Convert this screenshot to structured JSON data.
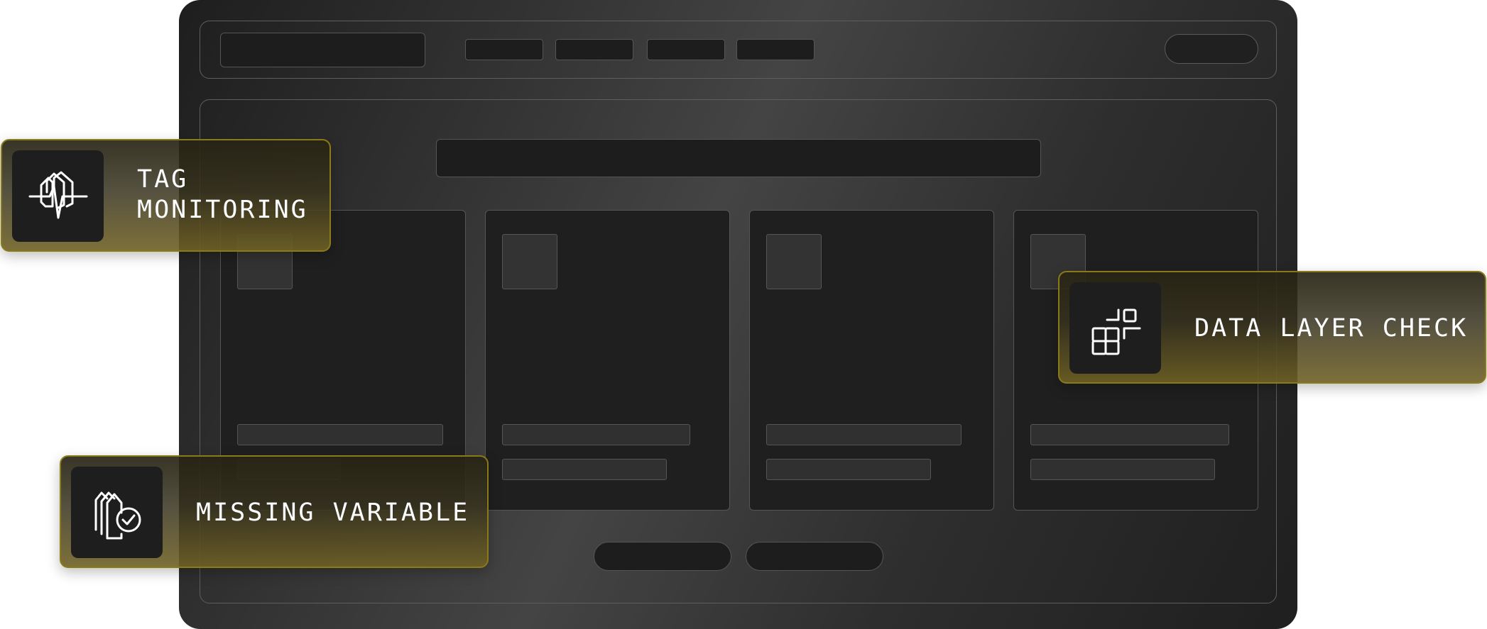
{
  "tags": [
    {
      "label": "TAG\nMONITORING",
      "icon": "tag-pulse-icon"
    },
    {
      "label": "DATA LAYER CHECK",
      "icon": "data-blocks-icon"
    },
    {
      "label": "MISSING VARIABLE",
      "icon": "tags-check-icon"
    }
  ],
  "colors": {
    "window_dark": "#1e1e1e",
    "window_light": "#444444",
    "tag_border": "#8a7a18",
    "tag_gold": "#6e6024",
    "text": "#ffffff"
  }
}
